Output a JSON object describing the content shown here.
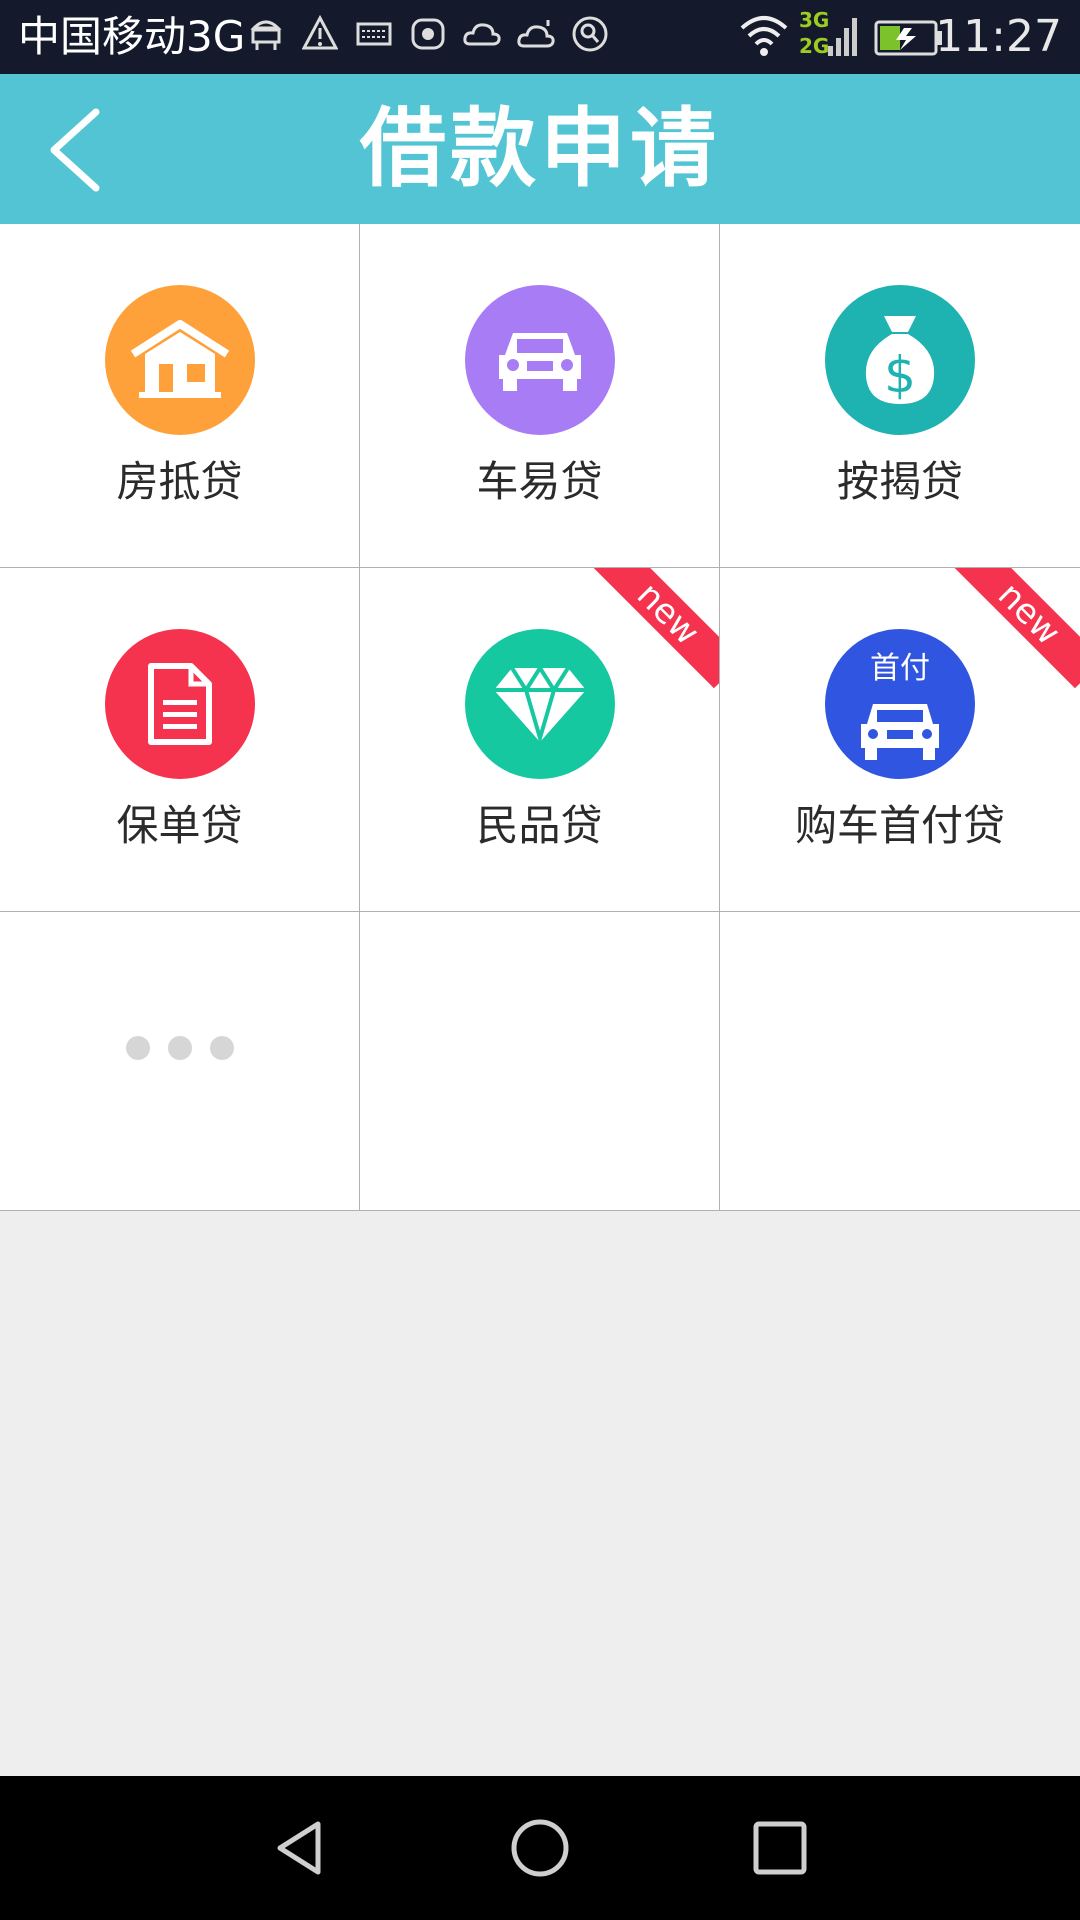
{
  "status_bar": {
    "carrier": "中国移动3G",
    "network_top": "3G",
    "network_bottom": "2G",
    "time": "11:27"
  },
  "header": {
    "title": "借款申请",
    "back_icon": "chevron-left-icon"
  },
  "loan_items": [
    {
      "label": "房抵贷",
      "icon": "house-icon",
      "color": "#ffa13b",
      "badge": ""
    },
    {
      "label": "车易贷",
      "icon": "car-icon",
      "color": "#a87cf5",
      "badge": ""
    },
    {
      "label": "按揭贷",
      "icon": "money-bag-icon",
      "color": "#1eb2b0",
      "badge": ""
    },
    {
      "label": "保单贷",
      "icon": "document-icon",
      "color": "#f5334f",
      "badge": ""
    },
    {
      "label": "民品贷",
      "icon": "diamond-icon",
      "color": "#16c8a0",
      "badge": "new"
    },
    {
      "label": "购车首付贷",
      "icon": "car-downpayment-icon",
      "icon_text": "首付",
      "color": "#3055e0",
      "badge": "new"
    }
  ],
  "more_item": {
    "icon": "more-dots-icon"
  },
  "badge_color": "#f5334f",
  "accent_color": "#52c4d4",
  "nav_bar": {
    "back": "triangle-back-icon",
    "home": "circle-home-icon",
    "recents": "square-recents-icon"
  }
}
